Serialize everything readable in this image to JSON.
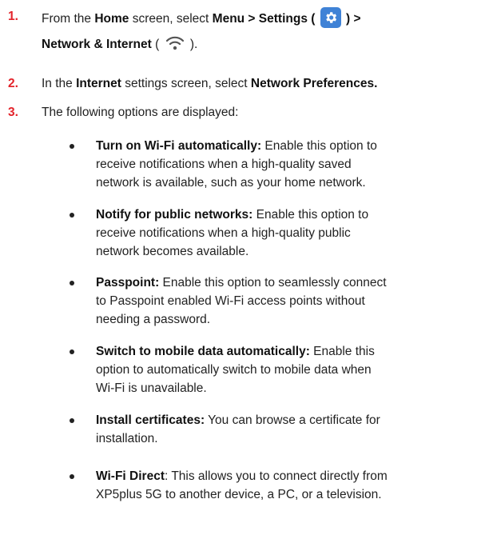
{
  "steps": [
    {
      "number": "1.",
      "parts": {
        "a": "From the ",
        "b": "Home",
        "c": " screen, select ",
        "d": "Menu > Settings",
        "e": " ( ",
        "f": " ) >",
        "g": "Network & Internet",
        "h": " ( ",
        "i": " )."
      },
      "icons": [
        "gear-icon",
        "wifi-icon"
      ],
      "icon_color": "#3f82d6"
    },
    {
      "number": "2.",
      "parts": {
        "a": "In the ",
        "b": "Internet",
        "c": " settings screen, select ",
        "d": "Network Preferences."
      }
    },
    {
      "number": "3.",
      "text": "The following options are displayed:"
    }
  ],
  "options": [
    {
      "title": "Turn on Wi-Fi automatically:",
      "lines": [
        " Enable this option to",
        "receive notifications when a high-quality saved",
        "network is available, such as your home network."
      ]
    },
    {
      "title": "Notify for public networks:",
      "lines": [
        " Enable this option to",
        "receive notifications when a high-quality public",
        "network becomes available."
      ]
    },
    {
      "title": "Passpoint:",
      "lines": [
        " Enable this option to seamlessly connect",
        "to Passpoint enabled Wi-Fi access points without",
        "needing a password."
      ]
    },
    {
      "title": "Switch to mobile data automatically:",
      "lines": [
        " Enable this",
        "option to automatically switch to mobile data when",
        "Wi-Fi is unavailable."
      ]
    },
    {
      "title": "Install certificates:",
      "lines": [
        " You can browse a certificate for",
        "installation."
      ]
    },
    {
      "title": "Wi-Fi Direct",
      "lines": [
        ": This allows you to connect directly from",
        "XP5plus 5G to another device, a PC, or a television."
      ]
    }
  ],
  "colors": {
    "step_number": "#e3242b",
    "text": "#222222"
  }
}
